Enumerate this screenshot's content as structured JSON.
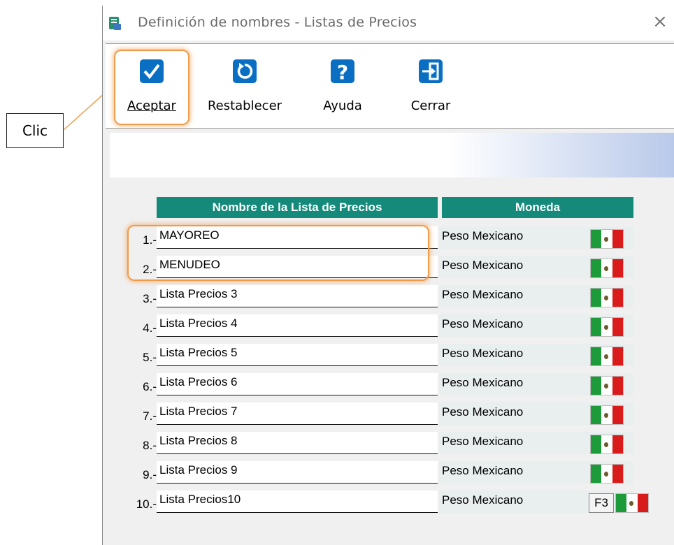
{
  "window": {
    "title": "Definición de nombres - Listas de Precios",
    "close_label": "×"
  },
  "toolbar": {
    "aceptar": "Aceptar",
    "restablecer": "Restablecer",
    "ayuda": "Ayuda",
    "cerrar": "Cerrar"
  },
  "annotation": {
    "callout": "Clic",
    "highlight_color": "#f19a4a"
  },
  "table": {
    "col_name": "Nombre de la Lista de Precios",
    "col_currency": "Moneda",
    "rows": [
      {
        "num": "1.-",
        "name": "MAYOREO",
        "currency": "Peso Mexicano"
      },
      {
        "num": "2.-",
        "name": "MENUDEO",
        "currency": "Peso Mexicano"
      },
      {
        "num": "3.-",
        "name": "Lista Precios 3",
        "currency": "Peso Mexicano"
      },
      {
        "num": "4.-",
        "name": "Lista Precios 4",
        "currency": "Peso Mexicano"
      },
      {
        "num": "5.-",
        "name": "Lista Precios 5",
        "currency": "Peso Mexicano"
      },
      {
        "num": "6.-",
        "name": "Lista Precios 6",
        "currency": "Peso Mexicano"
      },
      {
        "num": "7.-",
        "name": "Lista Precios 7",
        "currency": "Peso Mexicano"
      },
      {
        "num": "8.-",
        "name": "Lista Precios 8",
        "currency": "Peso Mexicano"
      },
      {
        "num": "9.-",
        "name": "Lista Precios 9",
        "currency": "Peso Mexicano"
      },
      {
        "num": "10.-",
        "name": "Lista Precios10",
        "currency": "Peso Mexicano"
      }
    ],
    "f3_label": "F3"
  },
  "colors": {
    "header_bg": "#158a7a",
    "icon_blue": "#0a6fc2",
    "flag_green": "#1d9a3a",
    "flag_red": "#d81c1c"
  }
}
